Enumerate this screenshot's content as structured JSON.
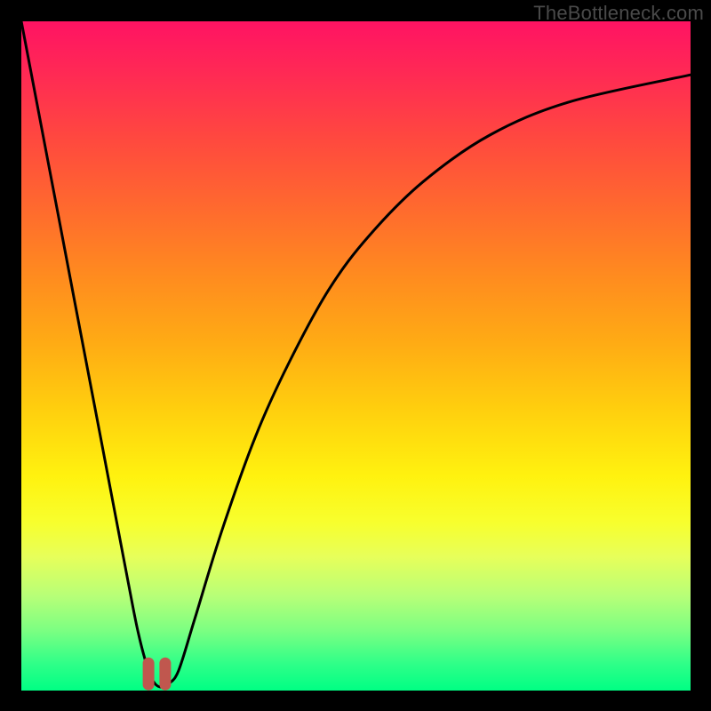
{
  "watermark": "TheBottleneck.com",
  "chart_data": {
    "type": "line",
    "title": "",
    "xlabel": "",
    "ylabel": "",
    "xlim": [
      0,
      100
    ],
    "ylim": [
      0,
      100
    ],
    "grid": false,
    "series": [
      {
        "name": "bottleneck-curve",
        "x": [
          0,
          4,
          8,
          12,
          16,
          17.5,
          19,
          20,
          21,
          22,
          23.5,
          26,
          30,
          35,
          40,
          46,
          52,
          60,
          70,
          82,
          100
        ],
        "y": [
          100,
          79,
          58,
          37,
          16,
          8.5,
          3,
          1,
          0.5,
          1,
          3,
          11,
          24,
          38,
          49,
          60,
          68,
          76,
          83,
          88,
          92
        ],
        "color": "#000000"
      }
    ],
    "markers": [
      {
        "name": "valley-left",
        "x": 19.0,
        "y": 2.5,
        "color": "#c0574e"
      },
      {
        "name": "valley-right",
        "x": 21.5,
        "y": 2.5,
        "color": "#c0574e"
      }
    ]
  },
  "colors": {
    "curve": "#000000",
    "marker": "#c0574e",
    "frame_bg": "#000000"
  }
}
